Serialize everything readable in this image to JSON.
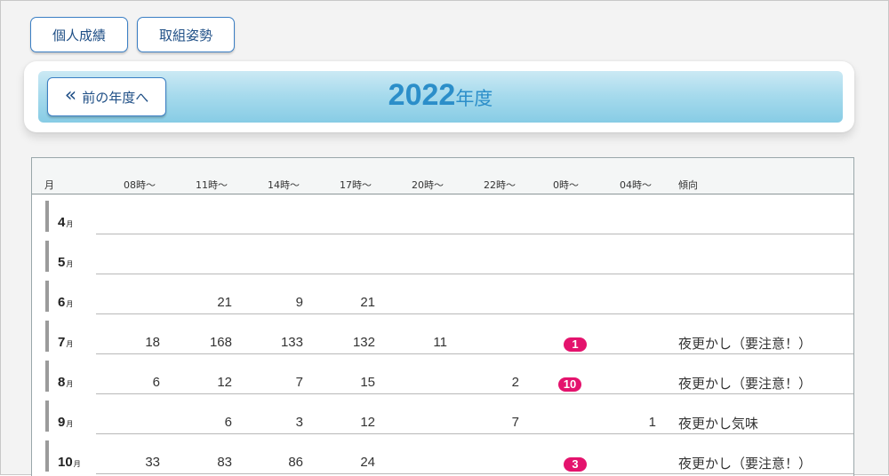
{
  "buttons": {
    "personal": "個人成績",
    "attitude": "取組姿勢"
  },
  "year_header": {
    "prev_label": "前の年度へ",
    "year": "2022",
    "year_suffix": "年度"
  },
  "table": {
    "columns": [
      "月",
      "08時～",
      "11時～",
      "14時～",
      "17時～",
      "20時～",
      "22時～",
      "0時～",
      "04時～",
      "傾向"
    ],
    "month_unit": "月",
    "rows": [
      {
        "month": "4",
        "c08": "",
        "c11": "",
        "c14": "",
        "c17": "",
        "c20": "",
        "c22": "",
        "c0": "",
        "c04": "",
        "trend": ""
      },
      {
        "month": "5",
        "c08": "",
        "c11": "",
        "c14": "",
        "c17": "",
        "c20": "",
        "c22": "",
        "c0": "",
        "c04": "",
        "trend": ""
      },
      {
        "month": "6",
        "c08": "",
        "c11": "21",
        "c14": "9",
        "c17": "21",
        "c20": "",
        "c22": "",
        "c0": "",
        "c04": "",
        "trend": ""
      },
      {
        "month": "7",
        "c08": "18",
        "c11": "168",
        "c14": "133",
        "c17": "132",
        "c20": "11",
        "c22": "",
        "c0": "1",
        "c04": "",
        "trend": "夜更かし（要注意！）"
      },
      {
        "month": "8",
        "c08": "6",
        "c11": "12",
        "c14": "7",
        "c17": "15",
        "c20": "",
        "c22": "2",
        "c0": "10",
        "c04": "",
        "trend": "夜更かし（要注意！）"
      },
      {
        "month": "9",
        "c08": "",
        "c11": "6",
        "c14": "3",
        "c17": "12",
        "c20": "",
        "c22": "7",
        "c0": "",
        "c04": "1",
        "trend": "夜更かし気味"
      },
      {
        "month": "10",
        "c08": "33",
        "c11": "83",
        "c14": "86",
        "c17": "24",
        "c20": "",
        "c22": "",
        "c0": "3",
        "c04": "",
        "trend": "夜更かし（要注意！）"
      }
    ]
  },
  "colors": {
    "accent": "#2b8ec9",
    "badge": "#e4136d",
    "button_border": "#3b7fc4"
  }
}
